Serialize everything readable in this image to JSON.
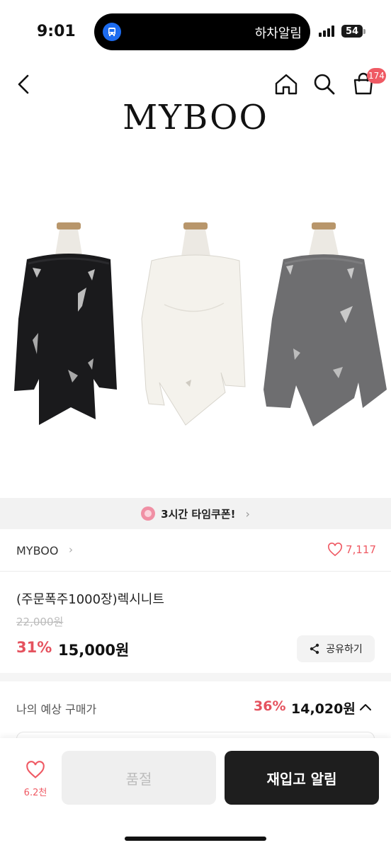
{
  "status_bar": {
    "time": "9:01",
    "island_text": "하차알림",
    "battery": "54",
    "app_icon": "bus-icon"
  },
  "nav": {
    "back_icon": "chevron-left-icon",
    "home_icon": "home-icon",
    "search_icon": "search-icon",
    "cart_icon": "shopping-bag-icon",
    "cart_count": "174"
  },
  "product": {
    "brand_logo": "MYBOO",
    "image_colors": [
      "#1a1a1c",
      "#f4f2ec",
      "#6e6e70"
    ],
    "shop_name": "MYBOO",
    "like_count": "7,117",
    "name": "(주문폭주1000장)렉시니트",
    "original_price": "22,000원",
    "discount_rate": "31%",
    "sale_price": "15,000원",
    "share_label": "공유하기"
  },
  "coupon": {
    "text": "3시간 타임쿠폰!",
    "icon": "alarm-clock-icon"
  },
  "expected_price": {
    "label": "나의 예상 구매가",
    "rate": "36%",
    "price": "14,020원"
  },
  "bottom_bar": {
    "wish_count": "6.2천",
    "soldout_label": "품절",
    "restock_label": "재입고 알림"
  },
  "colors": {
    "accent": "#e5525e",
    "dark_button": "#1e1e1e"
  }
}
